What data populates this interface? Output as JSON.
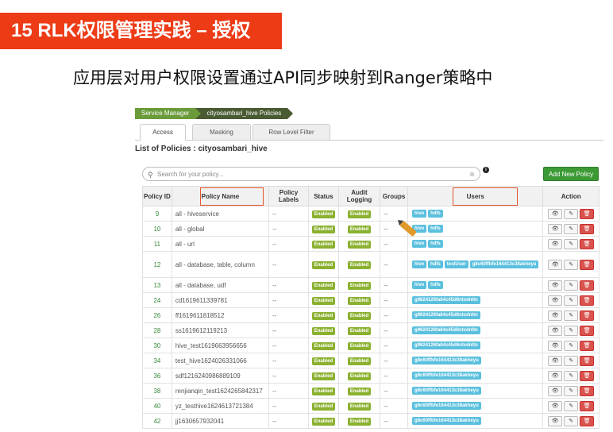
{
  "slide": {
    "title": "15 RLK权限管理实践 – 授权",
    "subtitle": "应用层对用户权限设置通过API同步映射到Ranger策略中"
  },
  "breadcrumb": [
    "Service Manager",
    "cityosambari_hive Policies"
  ],
  "tabs": [
    "Access",
    "Masking",
    "Row Level Filter"
  ],
  "list_title": "List of Policies : cityosambari_hive",
  "search": {
    "placeholder": "Search for your policy...",
    "clear": "⊗"
  },
  "add_button": "Add New Policy",
  "columns": [
    "Policy ID",
    "Policy Name",
    "Policy Labels",
    "Status",
    "Audit Logging",
    "Groups",
    "Users",
    "Action"
  ],
  "policies": [
    {
      "id": "9",
      "name": "all - hiveservice",
      "labels": "--",
      "status": "Enabled",
      "audit": "Enabled",
      "groups": "--",
      "users": [
        "hive",
        "hdfs"
      ]
    },
    {
      "id": "10",
      "name": "all - global",
      "labels": "--",
      "status": "Enabled",
      "audit": "Enabled",
      "groups": "--",
      "users": [
        "hive",
        "hdfs"
      ]
    },
    {
      "id": "11",
      "name": "all - url",
      "labels": "--",
      "status": "Enabled",
      "audit": "Enabled",
      "groups": "--",
      "users": [
        "hive",
        "hdfs"
      ]
    },
    {
      "id": "12",
      "name": "all - database, table, column",
      "labels": "--",
      "status": "Enabled",
      "audit": "Enabled",
      "groups": "--",
      "users": [
        "hive",
        "hdfs",
        "testUser",
        "g8c60ffbfe164413c38akheyu"
      ]
    },
    {
      "id": "13",
      "name": "all - database, udf",
      "labels": "--",
      "status": "Enabled",
      "audit": "Enabled",
      "groups": "--",
      "users": [
        "hive",
        "hdfs"
      ]
    },
    {
      "id": "24",
      "name": "cd1619611339781",
      "labels": "--",
      "status": "Enabled",
      "audit": "Enabled",
      "groups": "--",
      "users": [
        "g9624126fa64c45d6ntxdnltn"
      ]
    },
    {
      "id": "26",
      "name": "ff1619611818512",
      "labels": "--",
      "status": "Enabled",
      "audit": "Enabled",
      "groups": "--",
      "users": [
        "g9624126fa64c45d6ntxdnltn"
      ]
    },
    {
      "id": "28",
      "name": "ss1619612119213",
      "labels": "--",
      "status": "Enabled",
      "audit": "Enabled",
      "groups": "--",
      "users": [
        "g9624126fa64c45d6ntxdnltn"
      ]
    },
    {
      "id": "30",
      "name": "hive_test1619663956656",
      "labels": "--",
      "status": "Enabled",
      "audit": "Enabled",
      "groups": "--",
      "users": [
        "g9624126fa64c45d6ntxdnltn"
      ]
    },
    {
      "id": "34",
      "name": "test_hive1624026331066",
      "labels": "--",
      "status": "Enabled",
      "audit": "Enabled",
      "groups": "--",
      "users": [
        "g8c60ffbfe164413c38akheyu"
      ]
    },
    {
      "id": "36",
      "name": "sdf1216240986889109",
      "labels": "--",
      "status": "Enabled",
      "audit": "Enabled",
      "groups": "--",
      "users": [
        "g8c60ffbfe164413c38akheyu"
      ]
    },
    {
      "id": "38",
      "name": "renjianqin_test1624265842317",
      "labels": "--",
      "status": "Enabled",
      "audit": "Enabled",
      "groups": "--",
      "users": [
        "g8c60ffbfe164413c38akheyu"
      ]
    },
    {
      "id": "40",
      "name": "yz_testhive1624613721384",
      "labels": "--",
      "status": "Enabled",
      "audit": "Enabled",
      "groups": "--",
      "users": [
        "g8c60ffbfe164413c38akheyu"
      ]
    },
    {
      "id": "42",
      "name": "jj1630657932041",
      "labels": "--",
      "status": "Enabled",
      "audit": "Enabled",
      "groups": "--",
      "users": [
        "g8c60ffbfe164413c38akheyu"
      ]
    }
  ],
  "icons": {
    "search": "search-icon",
    "info": "info-icon",
    "view": "eye-icon",
    "edit": "edit-icon",
    "delete": "trash-icon",
    "annotation": "pencil-icon"
  },
  "colors": {
    "title_bg": "#ed3b16",
    "highlight": "#e4572e",
    "enabled": "#8bb130",
    "user_label": "#5bc0de",
    "add_button": "#3c9a35"
  }
}
